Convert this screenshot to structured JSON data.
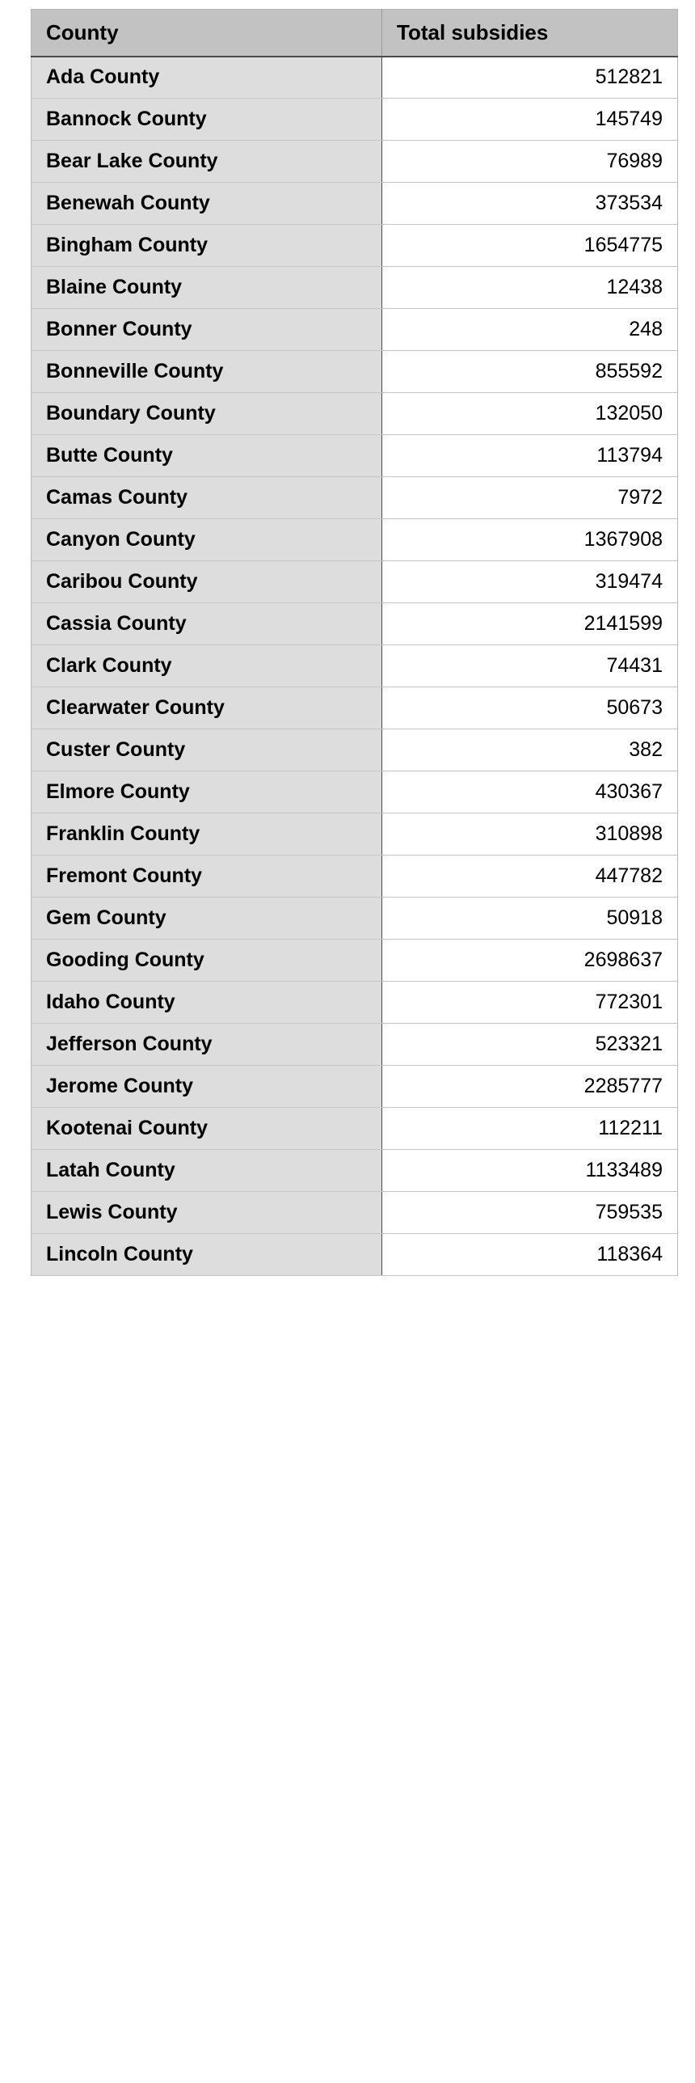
{
  "table": {
    "columns": [
      {
        "key": "county",
        "label": "County",
        "align": "left"
      },
      {
        "key": "value",
        "label": "Total subsidies",
        "align": "right"
      }
    ],
    "rows": [
      {
        "county": "Ada County",
        "value": "512821"
      },
      {
        "county": "Bannock County",
        "value": "145749"
      },
      {
        "county": "Bear Lake County",
        "value": "76989"
      },
      {
        "county": "Benewah County",
        "value": "373534"
      },
      {
        "county": "Bingham County",
        "value": "1654775"
      },
      {
        "county": "Blaine County",
        "value": "12438"
      },
      {
        "county": "Bonner County",
        "value": "248"
      },
      {
        "county": "Bonneville County",
        "value": "855592"
      },
      {
        "county": "Boundary County",
        "value": "132050"
      },
      {
        "county": "Butte County",
        "value": "113794"
      },
      {
        "county": "Camas County",
        "value": "7972"
      },
      {
        "county": "Canyon County",
        "value": "1367908"
      },
      {
        "county": "Caribou County",
        "value": "319474"
      },
      {
        "county": "Cassia County",
        "value": "2141599"
      },
      {
        "county": "Clark County",
        "value": "74431"
      },
      {
        "county": "Clearwater County",
        "value": "50673"
      },
      {
        "county": "Custer County",
        "value": "382"
      },
      {
        "county": "Elmore County",
        "value": "430367"
      },
      {
        "county": "Franklin County",
        "value": "310898"
      },
      {
        "county": "Fremont County",
        "value": "447782"
      },
      {
        "county": "Gem County",
        "value": "50918"
      },
      {
        "county": "Gooding County",
        "value": "2698637"
      },
      {
        "county": "Idaho County",
        "value": "772301"
      },
      {
        "county": "Jefferson County",
        "value": "523321"
      },
      {
        "county": "Jerome County",
        "value": "2285777"
      },
      {
        "county": "Kootenai County",
        "value": "112211"
      },
      {
        "county": "Latah County",
        "value": "1133489"
      },
      {
        "county": "Lewis County",
        "value": "759535"
      },
      {
        "county": "Lincoln County",
        "value": "118364"
      }
    ]
  },
  "chart_data": {
    "type": "table",
    "title": "",
    "columns": [
      "County",
      "Total subsidies"
    ],
    "categories": [
      "Ada County",
      "Bannock County",
      "Bear Lake County",
      "Benewah County",
      "Bingham County",
      "Blaine County",
      "Bonner County",
      "Bonneville County",
      "Boundary County",
      "Butte County",
      "Camas County",
      "Canyon County",
      "Caribou County",
      "Cassia County",
      "Clark County",
      "Clearwater County",
      "Custer County",
      "Elmore County",
      "Franklin County",
      "Fremont County",
      "Gem County",
      "Gooding County",
      "Idaho County",
      "Jefferson County",
      "Jerome County",
      "Kootenai County",
      "Latah County",
      "Lewis County",
      "Lincoln County"
    ],
    "values": [
      512821,
      145749,
      76989,
      373534,
      1654775,
      12438,
      248,
      855592,
      132050,
      113794,
      7972,
      1367908,
      319474,
      2141599,
      74431,
      50673,
      382,
      430367,
      310898,
      447782,
      50918,
      2698637,
      772301,
      523321,
      2285777,
      112211,
      1133489,
      759535,
      118364
    ],
    "xlabel": "County",
    "ylabel": "Total subsidies"
  }
}
